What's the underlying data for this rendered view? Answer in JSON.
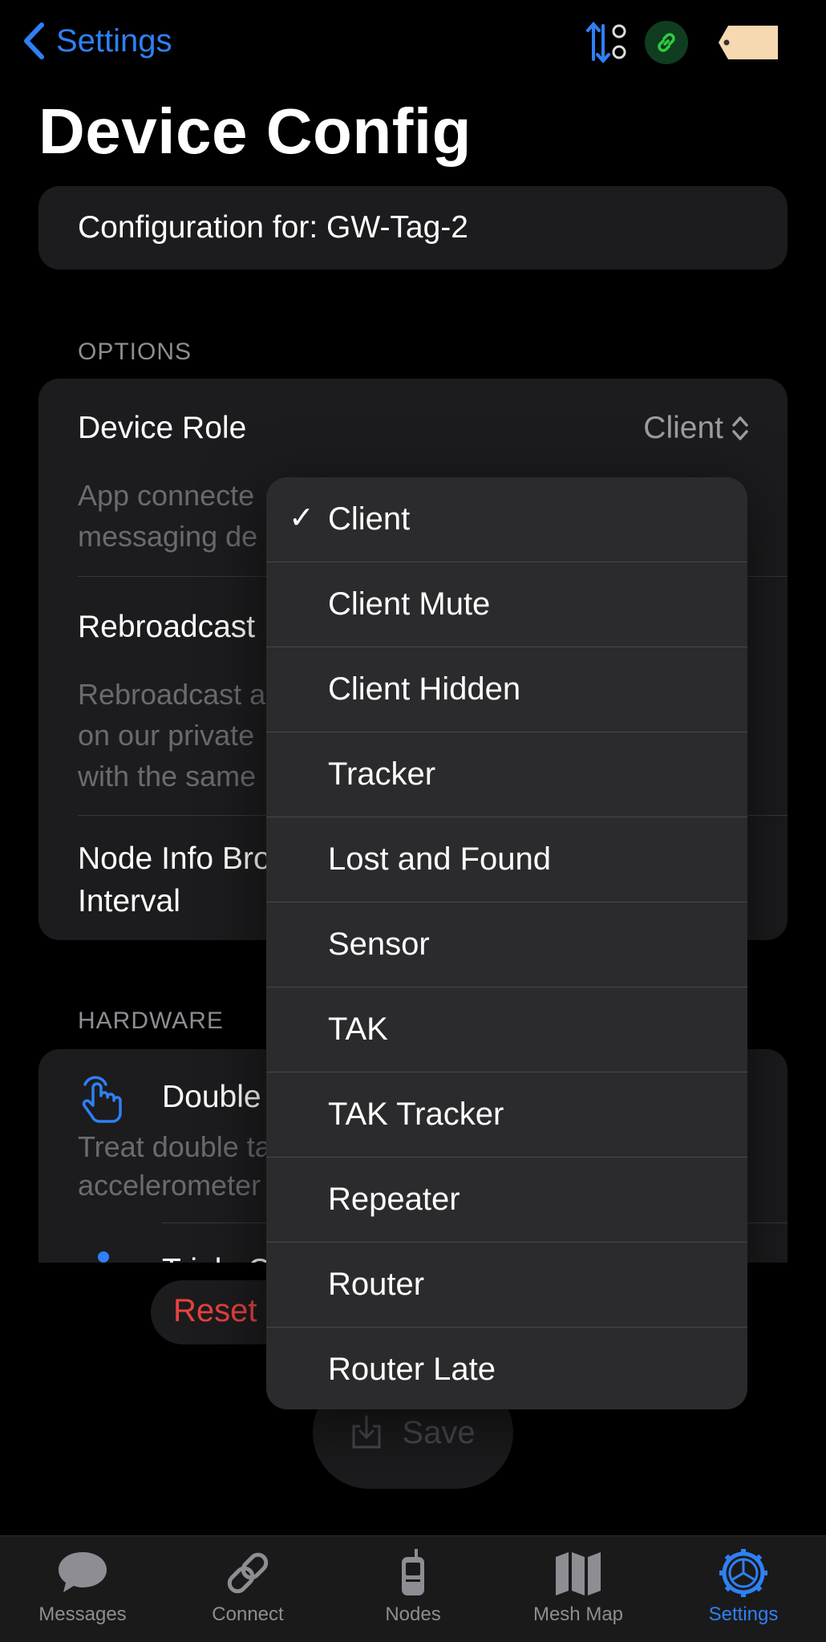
{
  "nav": {
    "back_label": "Settings"
  },
  "title": "Device Config",
  "config_for": "Configuration for: GW-Tag-2",
  "options": {
    "section": "OPTIONS",
    "device_role_label": "Device Role",
    "device_role_value": "Client",
    "device_role_desc_1": "App connecte",
    "device_role_desc_2": "messaging de",
    "rebroadcast_label": "Rebroadcast",
    "rebroadcast_desc_1": "Rebroadcast a",
    "rebroadcast_desc_2": "on our private",
    "rebroadcast_desc_3": "with the same",
    "nodeinfo_label_1": "Node Info Bro",
    "nodeinfo_label_2": "Interval"
  },
  "hardware": {
    "section": "HARDWARE",
    "double_label": "Double",
    "double_desc_1": "Treat double ta",
    "double_desc_2": "accelerometer",
    "triple_label": "Triple C"
  },
  "actions": {
    "reset": "Reset",
    "save": "Save"
  },
  "role_menu": {
    "selected": "Client",
    "items": [
      "Client",
      "Client Mute",
      "Client Hidden",
      "Tracker",
      "Lost and Found",
      "Sensor",
      "TAK",
      "TAK Tracker",
      "Repeater",
      "Router",
      "Router Late"
    ]
  },
  "tabs": [
    {
      "label": "Messages",
      "icon": "message-bubble-icon"
    },
    {
      "label": "Connect",
      "icon": "link-icon"
    },
    {
      "label": "Nodes",
      "icon": "radio-device-icon"
    },
    {
      "label": "Mesh Map",
      "icon": "map-icon"
    },
    {
      "label": "Settings",
      "icon": "gear-icon",
      "active": true
    }
  ],
  "colors": {
    "accent": "#2f80f6",
    "destructive": "#e8423f",
    "connected": "#2ecc40"
  }
}
